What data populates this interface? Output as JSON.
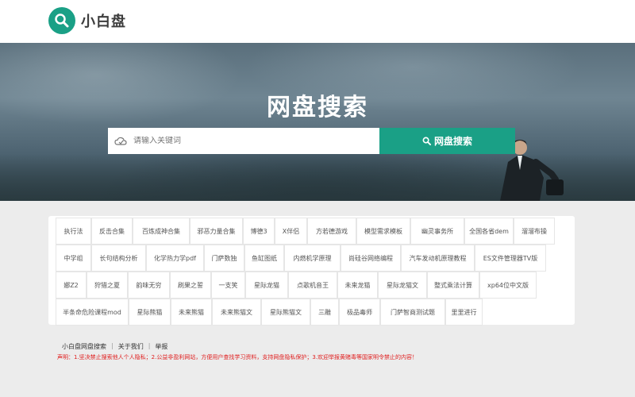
{
  "header": {
    "logo_text": "小白盘"
  },
  "hero": {
    "title": "网盘搜索",
    "search_placeholder": "请输入关键词",
    "search_button": "网盘搜索"
  },
  "tags": [
    "执行法",
    "反击合集",
    "百炼成神合集",
    "邪恶力量合集",
    "博德3",
    "X伴侣",
    "方若德游戏",
    "模型需求模板",
    "幽灵事务所",
    "全国各省dem",
    "溜溜布操",
    "中学组",
    "长句结构分析",
    "化学热力学pdf",
    "门萨数独",
    "鱼缸图纸",
    "内燃机学原理",
    "尚硅谷网络编程",
    "汽车发动机原理教程",
    "ES文件管理器TV版",
    "娜Z2",
    "狩猎之夏",
    "韵味无穷",
    "刷果之誓",
    "一支笑",
    "星际龙猫",
    "点歌机音王",
    "未来龙猫",
    "星际龙猫文",
    "整式乘法计算",
    "xp64位中文版",
    "半条命危险课程mod",
    "星际熊猫",
    "未来熊猫",
    "未来熊猫文",
    "星际熊猫文",
    "三雕",
    "极品毒师",
    "门萨智商测试题",
    "里里进行"
  ],
  "footer": {
    "links": [
      "小白盘网盘搜索",
      "关于我们",
      "举报"
    ],
    "notice": "声明：1.坚决禁止搜索他人个人隐私；2.公益非盈利网站，方便用户查找学习资料，支持网盘隐私保护；3.欢迎举报黄赌毒等国家明令禁止的内容！"
  },
  "colors": {
    "accent": "#1aa086",
    "notice": "#e02020"
  },
  "icons": {
    "logo": "search-icon",
    "search_box": "cloud-icon",
    "search_button": "search-icon"
  }
}
